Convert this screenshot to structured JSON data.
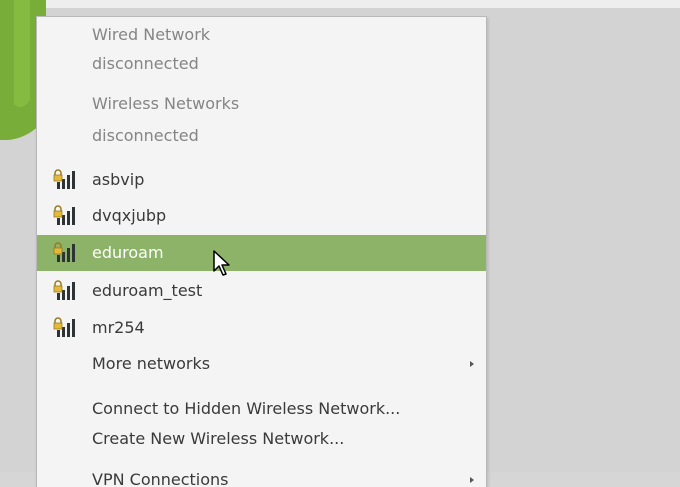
{
  "menu": {
    "wired_header": "Wired Network",
    "wired_status": "disconnected",
    "wireless_header": "Wireless Networks",
    "wireless_status": "disconnected",
    "networks": [
      {
        "name": "asbvip",
        "icon": "locked-wifi-signal-icon"
      },
      {
        "name": "dvqxjubp",
        "icon": "locked-wifi-signal-icon"
      },
      {
        "name": "eduroam",
        "icon": "locked-wifi-signal-icon",
        "highlighted": true
      },
      {
        "name": "eduroam_test",
        "icon": "locked-wifi-signal-icon"
      },
      {
        "name": "mr254",
        "icon": "locked-wifi-signal-icon"
      }
    ],
    "more_networks": "More networks",
    "connect_hidden": "Connect to Hidden Wireless Network...",
    "create_new": "Create New Wireless Network...",
    "vpn_connections": "VPN Connections"
  },
  "colors": {
    "highlight": "#8cb368",
    "menu_bg": "#f4f4f4",
    "desktop_bg": "#d3d3d3",
    "lock": "#e2b93b",
    "signal": "#2e3436"
  }
}
